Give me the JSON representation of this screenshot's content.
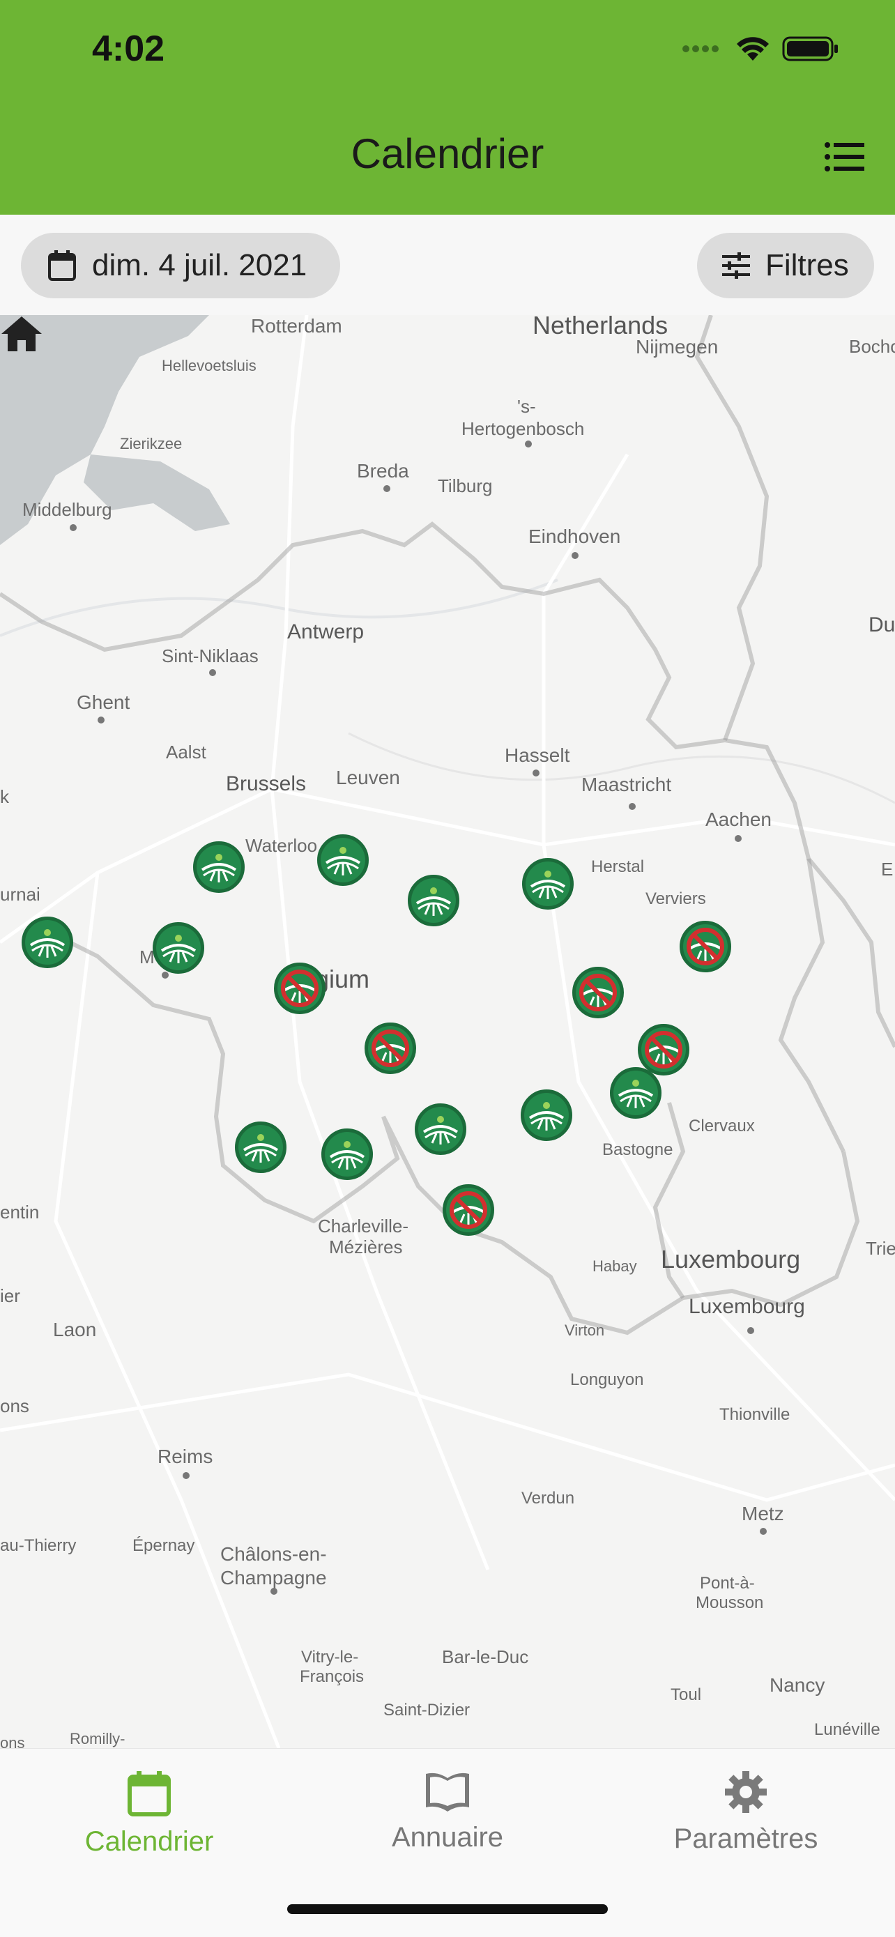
{
  "status": {
    "time": "4:02"
  },
  "header": {
    "title": "Calendrier"
  },
  "toolbar": {
    "date": "dim. 4 juil. 2021",
    "filters": "Filtres"
  },
  "map": {
    "labels": {
      "netherlands": "Netherlands",
      "rotterdam": "Rotterdam",
      "nijmegen": "Nijmegen",
      "bocholt": "Bocho",
      "hellevoetsluis": "Hellevoetsluis",
      "s": "'s-",
      "hertogenbosch": "Hertogenbosch",
      "zierikzee": "Zierikzee",
      "breda": "Breda",
      "tilburg": "Tilburg",
      "middelburg": "Middelburg",
      "eindhoven": "Eindhoven",
      "antwerp": "Antwerp",
      "sint_niklaas": "Sint-Niklaas",
      "du": "Du",
      "ghent": "Ghent",
      "aalst": "Aalst",
      "hasselt": "Hasselt",
      "brussels": "Brussels",
      "leuven": "Leuven",
      "maastricht": "Maastricht",
      "k": "k",
      "aachen": "Aachen",
      "waterloo": "Waterloo",
      "herstal": "Herstal",
      "e": "E",
      "urnai": "urnai",
      "verviers": "Verviers",
      "m": "M",
      "belgium": "lgium",
      "clervaux": "Clervaux",
      "bastogne": "Bastogne",
      "entin": "entin",
      "charleville": "Charleville-",
      "mezieres": "Mézières",
      "luxembourg_country": "Luxembourg",
      "trie": "Trie",
      "habay": "Habay",
      "luxembourg_city": "Luxembourg",
      "ier": "ier",
      "laon": "Laon",
      "virton": "Virton",
      "longuyon": "Longuyon",
      "ons": "ons",
      "thionville": "Thionville",
      "reims": "Reims",
      "verdun": "Verdun",
      "metz": "Metz",
      "au_thierry": "au-Thierry",
      "epernay": "Épernay",
      "chalons": "Châlons-en-",
      "champagne": "Champagne",
      "pont": "Pont-à-",
      "mousson": "Mousson",
      "vitry": "Vitry-le-",
      "francois": "François",
      "bar_le_duc": "Bar-le-Duc",
      "nancy": "Nancy",
      "toul": "Toul",
      "saint_dizier": "Saint-Dizier",
      "romilly": "Romilly-",
      "luneville": "Lunéville",
      "ons2": "ons"
    },
    "markers": [
      {
        "status": "open"
      },
      {
        "status": "open"
      },
      {
        "status": "open"
      },
      {
        "status": "closed"
      },
      {
        "status": "open"
      },
      {
        "status": "open"
      },
      {
        "status": "open"
      },
      {
        "status": "closed"
      },
      {
        "status": "closed"
      },
      {
        "status": "closed"
      },
      {
        "status": "closed"
      },
      {
        "status": "open"
      },
      {
        "status": "open"
      },
      {
        "status": "open"
      },
      {
        "status": "open"
      },
      {
        "status": "open"
      },
      {
        "status": "closed"
      }
    ]
  },
  "tabs": [
    {
      "label": "Calendrier",
      "icon": "calendar-icon",
      "active": true
    },
    {
      "label": "Annuaire",
      "icon": "book-icon",
      "active": false
    },
    {
      "label": "Paramètres",
      "icon": "gear-icon",
      "active": false
    }
  ],
  "colors": {
    "accent": "#6db534",
    "marker_open": "#1e7b45",
    "marker_closed": "#d32f2f"
  }
}
